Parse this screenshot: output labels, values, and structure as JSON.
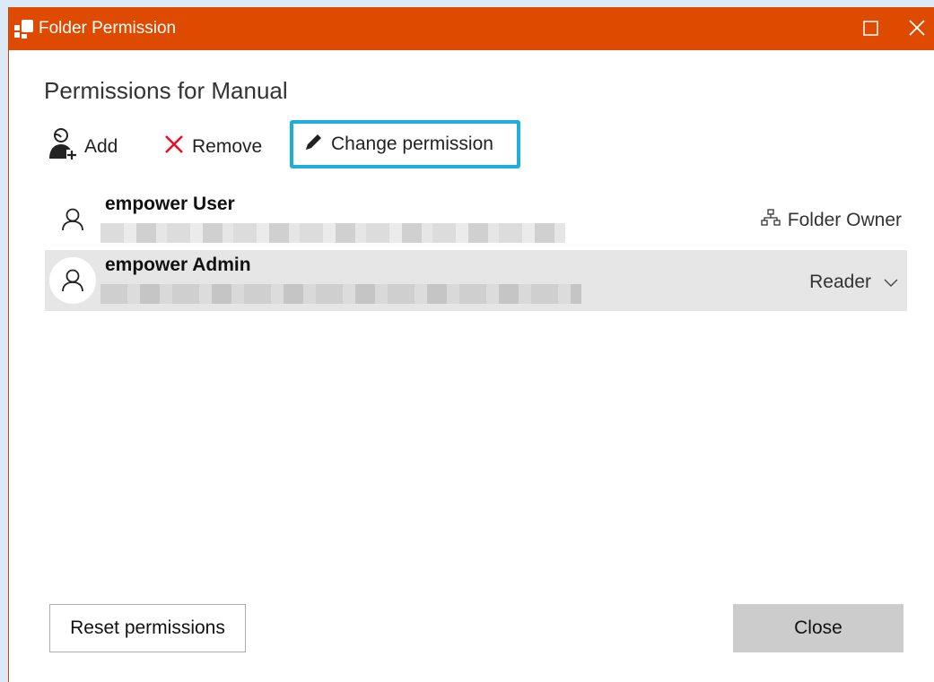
{
  "window": {
    "title": "Folder Permission",
    "accent_color": "#de4b00",
    "icons": {
      "app": "app-logo-icon",
      "maximize": "maximize-icon",
      "close": "close-icon"
    }
  },
  "heading": "Permissions for Manual",
  "toolbar": {
    "add_label": "Add",
    "remove_label": "Remove",
    "change_label": "Change permission",
    "highlight_color": "#1eaedb",
    "icons": {
      "add": "add-user-icon",
      "remove": "remove-x-icon",
      "change": "pencil-icon"
    }
  },
  "users": [
    {
      "name": "empower User",
      "role": "Folder Owner",
      "role_icon": "hierarchy-icon",
      "selected": false
    },
    {
      "name": "empower Admin",
      "role": "Reader",
      "role_icon": "chevron-down-icon",
      "selected": true
    }
  ],
  "footer": {
    "reset_label": "Reset permissions",
    "close_label": "Close"
  }
}
